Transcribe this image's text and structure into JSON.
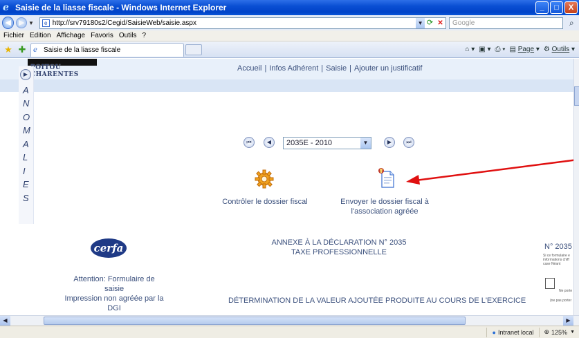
{
  "window": {
    "title": "Saisie de la liasse fiscale - Windows Internet Explorer",
    "min": "_",
    "max": "□",
    "close": "X"
  },
  "address": {
    "url": "http://srv79180s2/Cegid/SaisieWeb/saisie.aspx",
    "search_placeholder": "Google"
  },
  "menu": [
    "Fichier",
    "Edition",
    "Affichage",
    "Favoris",
    "Outils",
    "?"
  ],
  "tab": {
    "label": "Saisie de la liasse fiscale"
  },
  "toolbar": {
    "page_label": "Page",
    "tools_label": "Outils"
  },
  "site": {
    "logo_text": "POITOU CHARENTES",
    "nav": [
      "Accueil",
      "Infos Adhérent",
      "Saisie",
      "Ajouter un justificatif"
    ]
  },
  "anomalies": {
    "letters": [
      "A",
      "N",
      "O",
      "M",
      "A",
      "L",
      "I",
      "E",
      "S"
    ]
  },
  "period": {
    "selected": "2035E - 2010"
  },
  "actions": {
    "control_label": "Contrôler le dossier fiscal",
    "send_label_1": "Envoyer le dossier fiscal à",
    "send_label_2": "l'association agréée"
  },
  "form": {
    "cerfa": "cerfa",
    "annexe_1": "ANNEXE À LA DÉCLARATION N° 2035",
    "annexe_2": "TAXE PROFESSIONNELLE",
    "number": "N° 2035",
    "attention_1": "Attention: Formulaire de",
    "attention_2": "saisie",
    "attention_3": "Impression non agréée par la",
    "attention_4": "DGI",
    "determination": "DÉTERMINATION DE LA VALEUR AJOUTÉE PRODUITE AU COURS DE L'EXERCICE",
    "note_1": "Si ce formulaire e",
    "note_2": "informations chiff",
    "note_3": "case Néant",
    "note_4": "Ne porte",
    "note_5": "(ne pas porter"
  },
  "status": {
    "zone": "Intranet local",
    "zoom": "125%"
  }
}
